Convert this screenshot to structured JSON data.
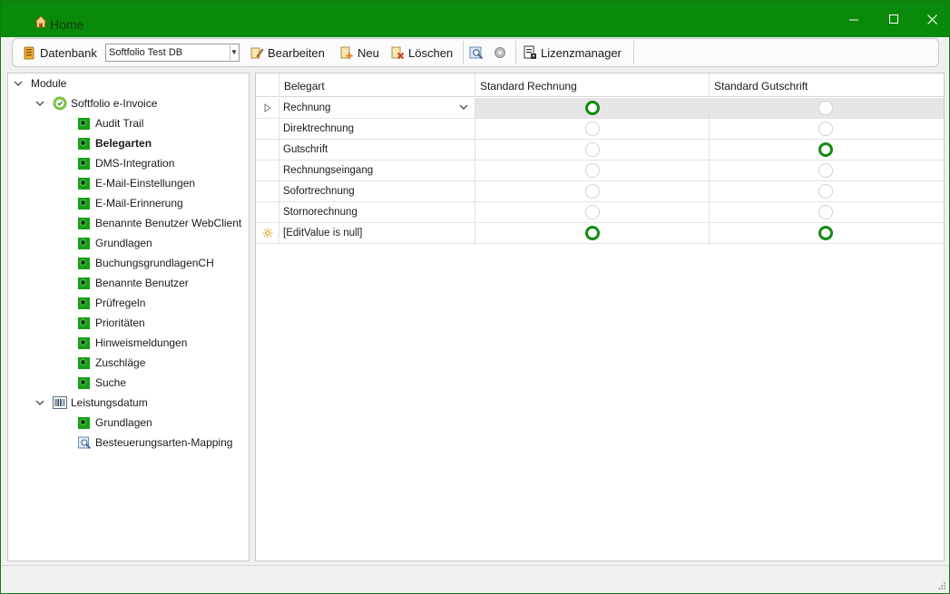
{
  "window": {
    "title": "Home",
    "icons": {
      "app": "home-icon",
      "minimize": "minimize-icon",
      "maximize": "maximize-icon",
      "close": "close-icon"
    }
  },
  "toolbar": {
    "database_label": "Datenbank",
    "database_value": "Softfolio Test DB",
    "edit_label": "Bearbeiten",
    "new_label": "Neu",
    "delete_label": "Löschen",
    "license_label": "Lizenzmanager",
    "icons": [
      "database-icon",
      "edit-icon",
      "new-icon",
      "delete-icon",
      "search-icon",
      "settings-icon",
      "license-icon"
    ]
  },
  "tree": {
    "root": "Module",
    "modules": [
      {
        "label": "Softfolio e-Invoice",
        "icon": "einvoice-icon",
        "children": [
          "Audit Trail",
          "Belegarten",
          "DMS-Integration",
          "E-Mail-Einstellungen",
          "E-Mail-Erinnerung",
          "Benannte Benutzer WebClient",
          "Grundlagen",
          "BuchungsgrundlagenCH",
          "Benannte Benutzer",
          "Prüfregeln",
          "Prioritäten",
          "Hinweismeldungen",
          "Zuschläge",
          "Suche"
        ],
        "selected": "Belegarten"
      },
      {
        "label": "Leistungsdatum",
        "icon": "barcode-icon",
        "children": [
          "Grundlagen",
          "Besteuerungsarten-Mapping"
        ]
      }
    ]
  },
  "grid": {
    "columns": [
      "Belegart",
      "Standard Rechnung",
      "Standard Gutschrift"
    ],
    "rows": [
      {
        "belegart": "Rechnung",
        "standard_rechnung": true,
        "standard_gutschrift": false
      },
      {
        "belegart": "Direktrechnung",
        "standard_rechnung": false,
        "standard_gutschrift": false
      },
      {
        "belegart": "Gutschrift",
        "standard_rechnung": false,
        "standard_gutschrift": true
      },
      {
        "belegart": "Rechnungseingang",
        "standard_rechnung": false,
        "standard_gutschrift": false
      },
      {
        "belegart": "Sofortrechnung",
        "standard_rechnung": false,
        "standard_gutschrift": false
      },
      {
        "belegart": "Stornorechnung",
        "standard_rechnung": false,
        "standard_gutschrift": false
      },
      {
        "belegart": "[EditValue is null]",
        "standard_rechnung": true,
        "standard_gutschrift": true
      }
    ],
    "colors": {
      "radio_on": "#138a13",
      "selected_row": "#e6e6e6",
      "titlebar": "#0a8a0a"
    }
  }
}
